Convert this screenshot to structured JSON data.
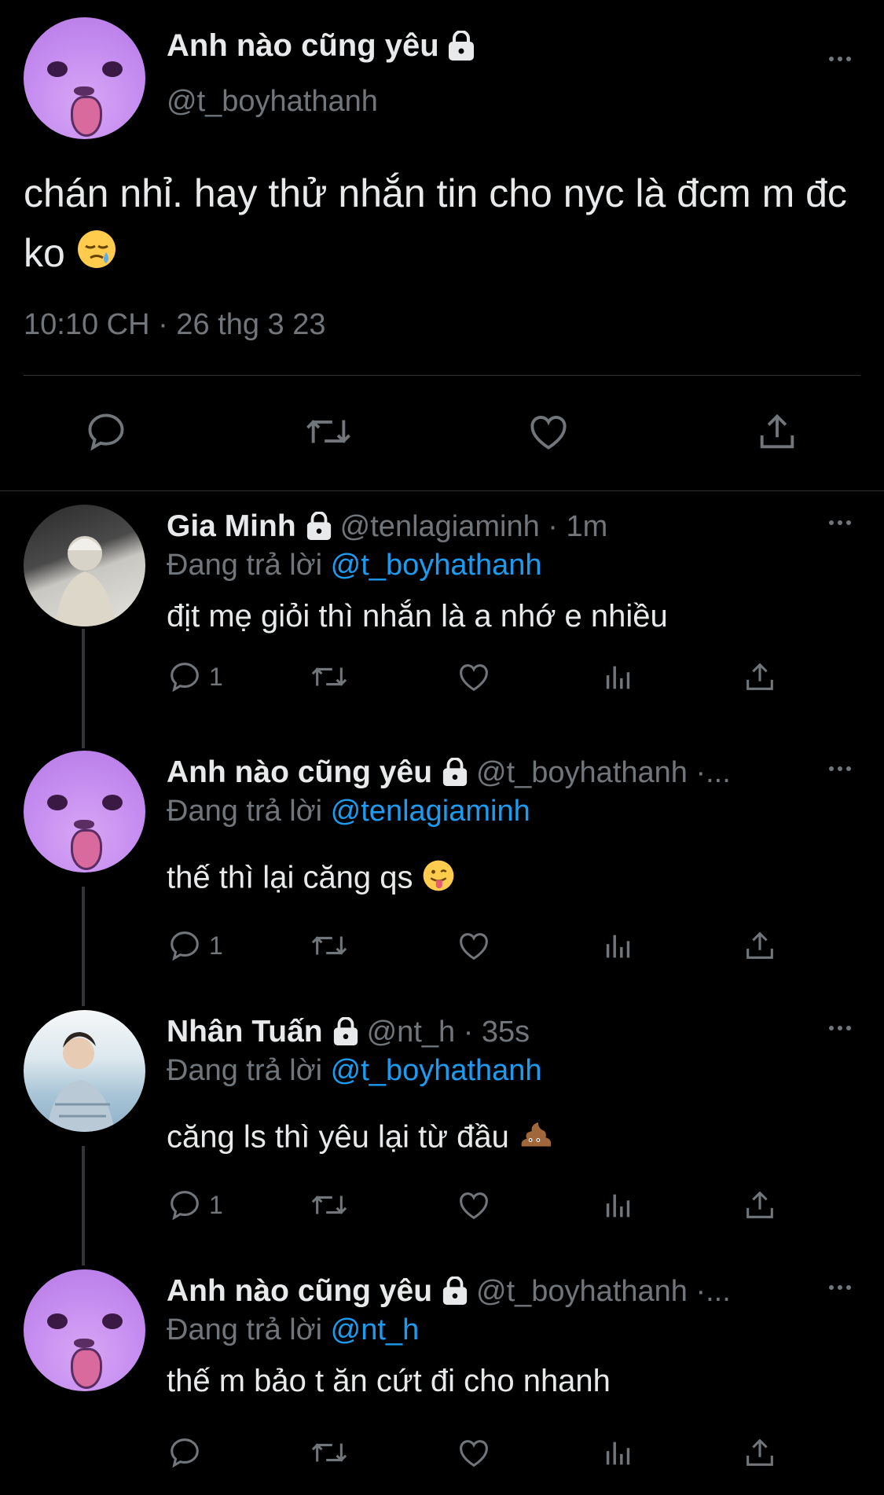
{
  "main_tweet": {
    "name": "Anh nào cũng yêu",
    "handle": "@t_boyhathanh",
    "text": "chán nhỉ. hay thử nhắn tin cho nyc là đcm m đc ko",
    "emoji": "sleepy-face",
    "timestamp": "10:10 CH · 26 thg 3 23"
  },
  "replies": [
    {
      "name": "Gia Minh",
      "handle": "@tenlagiaminh · 1m",
      "replying_prefix": "Đang trả lời ",
      "replying_to": "@t_boyhathanh",
      "text": "địt mẹ giỏi thì nhắn là a nhớ e nhiều",
      "reply_count": "1"
    },
    {
      "name": "Anh nào cũng yêu",
      "handle": "@t_boyhathanh ·...",
      "replying_prefix": "Đang trả lời ",
      "replying_to": "@tenlagiaminh",
      "text": "thế thì lại căng qs",
      "emoji": "tongue-face",
      "reply_count": "1"
    },
    {
      "name": "Nhân Tuấn",
      "handle": "@nt_h · 35s",
      "replying_prefix": "Đang trả lời ",
      "replying_to": "@t_boyhathanh",
      "text": "căng ls thì yêu lại từ đầu",
      "emoji": "pile-of-poo",
      "reply_count": "1"
    },
    {
      "name": "Anh nào cũng yêu",
      "handle": "@t_boyhathanh ·...",
      "replying_prefix": "Đang trả lời ",
      "replying_to": "@nt_h",
      "text": "thế m bảo t ăn cứt đi cho nhanh",
      "reply_count": ""
    }
  ],
  "colors": {
    "background": "#000000",
    "text": "#e7e9ea",
    "muted": "#71767b",
    "mention": "#1d9bf0",
    "divider": "#2f3336"
  }
}
